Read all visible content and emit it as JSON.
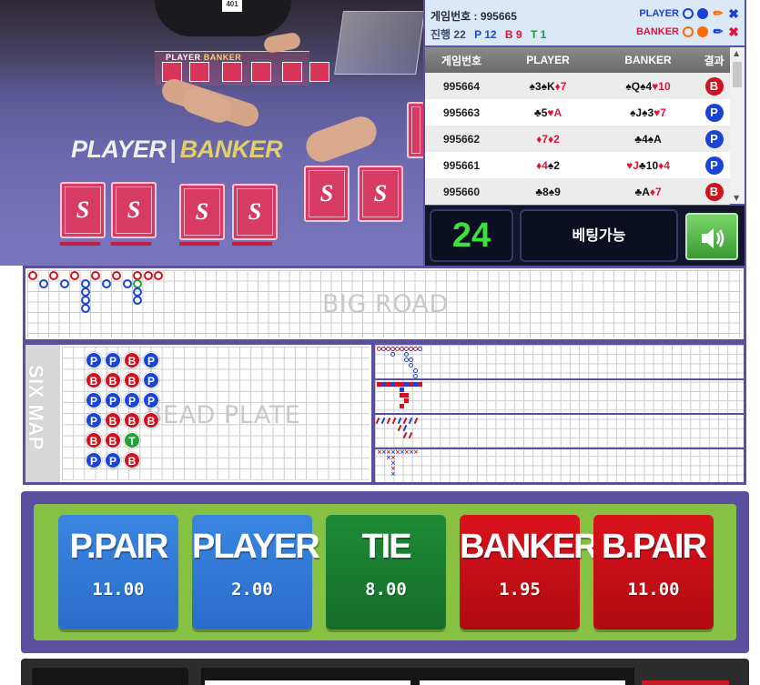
{
  "video": {
    "small_player": "PLAYER",
    "small_banker": "BANKER",
    "tag": "401",
    "player_label": "PLAYER",
    "banker_label": "BANKER"
  },
  "info": {
    "game_no_label": "게임번호 : 995665",
    "progress": {
      "label": "진행 22",
      "player": "P 12",
      "banker": "B 9",
      "tie": "T 1"
    },
    "player_side": "PLAYER",
    "banker_side": "BANKER",
    "colors": {
      "player": "#1a3fd6",
      "banker": "#e3143a",
      "tie": "#22a33a",
      "accent": "#5b4fa0"
    }
  },
  "history": {
    "headers": [
      "게임번호",
      "PLAYER",
      "BANKER",
      "결과"
    ],
    "rows": [
      {
        "game": "995664",
        "player": [
          [
            "♠3",
            "k"
          ],
          [
            "♠K",
            "k"
          ],
          [
            "♦7",
            "r"
          ]
        ],
        "banker": [
          [
            "♠Q",
            "k"
          ],
          [
            "♠4",
            "k"
          ],
          [
            "♥10",
            "r"
          ]
        ],
        "result": "B"
      },
      {
        "game": "995663",
        "player": [
          [
            "♣5",
            "k"
          ],
          [
            "♥A",
            "r"
          ]
        ],
        "banker": [
          [
            "♠J",
            "k"
          ],
          [
            "♠3",
            "k"
          ],
          [
            "♥7",
            "r"
          ]
        ],
        "result": "P"
      },
      {
        "game": "995662",
        "player": [
          [
            "♦7",
            "r"
          ],
          [
            "♦2",
            "r"
          ]
        ],
        "banker": [
          [
            "♣4",
            "k"
          ],
          [
            "♠A",
            "k"
          ]
        ],
        "result": "P"
      },
      {
        "game": "995661",
        "player": [
          [
            "♦4",
            "r"
          ],
          [
            "♠2",
            "k"
          ]
        ],
        "banker": [
          [
            "♥J",
            "r"
          ],
          [
            "♣10",
            "k"
          ],
          [
            "♦4",
            "r"
          ]
        ],
        "result": "P"
      },
      {
        "game": "995660",
        "player": [
          [
            "♣8",
            "k"
          ],
          [
            "♠9",
            "k"
          ]
        ],
        "banker": [
          [
            "♣A",
            "k"
          ],
          [
            "♦7",
            "r"
          ]
        ],
        "result": "B"
      }
    ]
  },
  "status": {
    "timer": "24",
    "betting": "베팅가능",
    "sound_icon": "speaker-icon"
  },
  "roads": {
    "big_road_label": "BIG ROAD",
    "six_map_label": "SIX MAP",
    "bead_plate_label": "BEAD PLATE",
    "bead_plate": [
      [
        "P",
        "B",
        "P",
        "P",
        "B",
        "P"
      ],
      [
        "P",
        "B",
        "P",
        "B",
        "B",
        "P"
      ],
      [
        "B",
        "B",
        "P",
        "B",
        "T",
        "B"
      ],
      [
        "P",
        "P",
        "P",
        "B"
      ]
    ]
  },
  "bets": [
    {
      "label": "P.PAIR",
      "odds": "11.00",
      "color": "blue"
    },
    {
      "label": "PLAYER",
      "odds": "2.00",
      "color": "blue"
    },
    {
      "label": "TIE",
      "odds": "8.00",
      "color": "green"
    },
    {
      "label": "BANKER",
      "odds": "1.95",
      "color": "red"
    },
    {
      "label": "B.PAIR",
      "odds": "11.00",
      "color": "red"
    }
  ]
}
